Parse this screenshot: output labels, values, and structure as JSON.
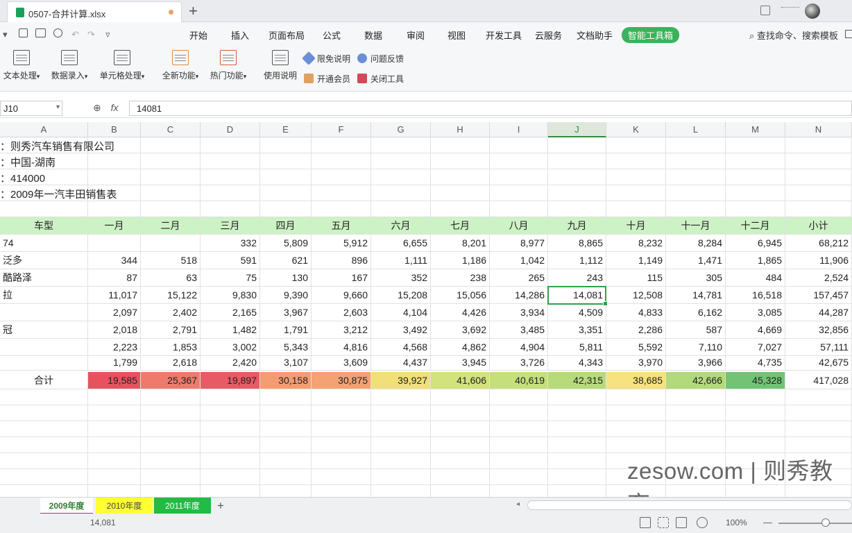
{
  "titlebar": {
    "doc_title": "0507-合并计算.xlsx",
    "new_tab_label": "+"
  },
  "menubar": {
    "items": [
      "开始",
      "插入",
      "页面布局",
      "公式",
      "数据",
      "审阅",
      "视图",
      "开发工具",
      "云服务",
      "文档助手",
      "智能工具箱"
    ],
    "active": "智能工具箱",
    "search": "查找命令、搜索模板"
  },
  "ribbon": {
    "buttons": [
      "文本处理",
      "数据录入",
      "单元格处理",
      "全新功能",
      "热门功能",
      "使用说明"
    ],
    "small": [
      "限免说明",
      "问题反馈",
      "开通会员",
      "关闭工具"
    ]
  },
  "formula_bar": {
    "name_box": "J10",
    "fx": "fx",
    "formula": "14081"
  },
  "columns": [
    "A",
    "B",
    "C",
    "D",
    "E",
    "F",
    "G",
    "H",
    "I",
    "J",
    "K",
    "L",
    "M",
    "N"
  ],
  "info_lines": [
    "：则秀汽车销售有限公司",
    "：中国-湖南",
    "：414000",
    "：2009年一汽丰田销售表"
  ],
  "table": {
    "headers": [
      "车型",
      "一月",
      "二月",
      "三月",
      "四月",
      "五月",
      "六月",
      "七月",
      "八月",
      "九月",
      "十月",
      "十一月",
      "十二月",
      "小计"
    ],
    "rows": [
      [
        "74",
        "",
        "",
        "332",
        "5,809",
        "5,912",
        "6,655",
        "8,201",
        "8,977",
        "8,865",
        "8,232",
        "8,284",
        "6,945",
        "68,212"
      ],
      [
        "泛多",
        "344",
        "518",
        "591",
        "621",
        "896",
        "1,111",
        "1,186",
        "1,042",
        "1,112",
        "1,149",
        "1,471",
        "1,865",
        "11,906"
      ],
      [
        "酷路泽",
        "87",
        "63",
        "75",
        "130",
        "167",
        "352",
        "238",
        "265",
        "243",
        "115",
        "305",
        "484",
        "2,524"
      ],
      [
        "拉",
        "11,017",
        "15,122",
        "9,830",
        "9,390",
        "9,660",
        "15,208",
        "15,056",
        "14,286",
        "14,081",
        "12,508",
        "14,781",
        "16,518",
        "157,457"
      ],
      [
        "",
        "2,097",
        "2,402",
        "2,165",
        "3,967",
        "2,603",
        "4,104",
        "4,426",
        "3,934",
        "4,509",
        "4,833",
        "6,162",
        "3,085",
        "44,287"
      ],
      [
        "冠",
        "2,018",
        "2,791",
        "1,482",
        "1,791",
        "3,212",
        "3,492",
        "3,692",
        "3,485",
        "3,351",
        "2,286",
        "587",
        "4,669",
        "32,856"
      ],
      [
        "",
        "2,223",
        "1,853",
        "3,002",
        "5,343",
        "4,816",
        "4,568",
        "4,862",
        "4,904",
        "5,811",
        "5,592",
        "7,110",
        "7,027",
        "57,111"
      ],
      [
        "",
        "1,799",
        "2,618",
        "2,420",
        "3,107",
        "3,609",
        "4,437",
        "3,945",
        "3,726",
        "4,343",
        "3,970",
        "3,966",
        "4,735",
        "42,675"
      ]
    ],
    "total_row": [
      "合计",
      "19,585",
      "25,367",
      "19,897",
      "30,158",
      "30,875",
      "39,927",
      "41,606",
      "40,619",
      "42,315",
      "38,685",
      "42,666",
      "45,328",
      "417,028"
    ],
    "total_colors": [
      "",
      "#e8525e",
      "#ef7a6c",
      "#e85a64",
      "#f49c72",
      "#f4a173",
      "#f1e07a",
      "#d2e27d",
      "#c5df7c",
      "#b7db7b",
      "#f6e27e",
      "#b2d97a",
      "#72c374",
      ""
    ]
  },
  "watermark": "zesow.com | 则秀教育",
  "sheets": [
    "2009年度",
    "2010年度",
    "2011年度"
  ],
  "status": {
    "sum": "14,081",
    "zoom": "100%"
  }
}
